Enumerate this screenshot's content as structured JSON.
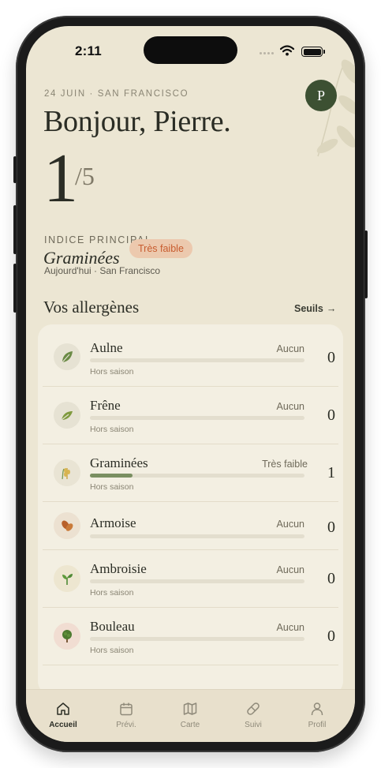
{
  "status_bar": {
    "time": "2:11"
  },
  "header": {
    "date_location": "24 JUIN · SAN FRANCISCO",
    "greeting": "Bonjour, Pierre.",
    "avatar_initial": "P"
  },
  "index": {
    "value": "1",
    "scale": "/5",
    "label": "INDICE PRINCIPAL",
    "main_allergen": "Graminées",
    "badge": "Très faible",
    "subtitle": "Aujourd'hui · San Francisco"
  },
  "allergens_section": {
    "title": "Vos allergènes",
    "link_label": "Seuils",
    "link_arrow": "→"
  },
  "allergens": [
    {
      "name": "Aulne",
      "level": "Aucun",
      "value": "0",
      "note": "Hors saison",
      "fill": 0,
      "icon": "leaf-icon"
    },
    {
      "name": "Frêne",
      "level": "Aucun",
      "value": "0",
      "note": "Hors saison",
      "fill": 0,
      "icon": "leaf-icon"
    },
    {
      "name": "Graminées",
      "level": "Très faible",
      "value": "1",
      "note": "Hors saison",
      "fill": 0.2,
      "icon": "wheat-icon"
    },
    {
      "name": "Armoise",
      "level": "Aucun",
      "value": "0",
      "note": "",
      "fill": 0,
      "icon": "herb-icon"
    },
    {
      "name": "Ambroisie",
      "level": "Aucun",
      "value": "0",
      "note": "Hors saison",
      "fill": 0,
      "icon": "sprout-icon"
    },
    {
      "name": "Bouleau",
      "level": "Aucun",
      "value": "0",
      "note": "Hors saison",
      "fill": 0,
      "icon": "tree-icon"
    }
  ],
  "tabs": [
    {
      "label": "Accueil",
      "icon": "home-icon",
      "active": true
    },
    {
      "label": "Prévi.",
      "icon": "calendar-icon",
      "active": false
    },
    {
      "label": "Carte",
      "icon": "map-icon",
      "active": false
    },
    {
      "label": "Suivi",
      "icon": "pill-icon",
      "active": false
    },
    {
      "label": "Profil",
      "icon": "user-icon",
      "active": false
    }
  ],
  "colors": {
    "background": "#ece6d3",
    "card": "#f3efe2",
    "accent_green": "#3c5032",
    "bar_fill": "#7a8f61",
    "badge_bg": "#ecc9ae",
    "badge_text": "#c85c2f"
  }
}
